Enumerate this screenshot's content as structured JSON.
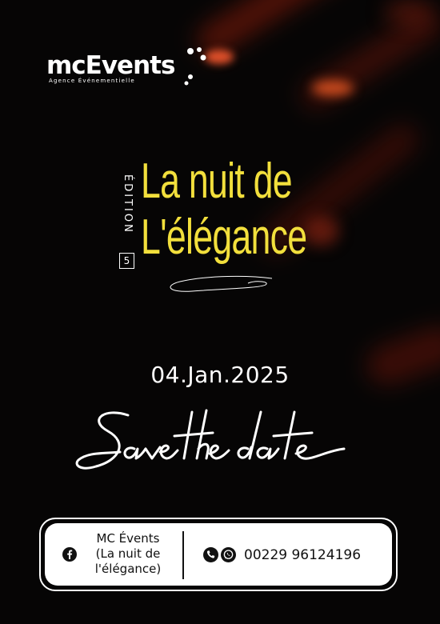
{
  "logo": {
    "name": "mcEvents",
    "tagline": "Agence Événementielle"
  },
  "title": {
    "edition_label": "ÉDITION",
    "edition_number": "5",
    "line1": "La nuit de",
    "line2": "L'élégance"
  },
  "event": {
    "date": "04.Jan.2025",
    "save_the_date": "Save the date"
  },
  "contact": {
    "name_lines": [
      "MC Évents",
      "(La nuit de",
      "l'élégance)"
    ],
    "phone": "00229 96124196",
    "icons": [
      "facebook-icon",
      "phone-icon",
      "whatsapp-icon"
    ]
  },
  "colors": {
    "background": "#050404",
    "title_yellow": "#f2df3c",
    "accent_orange": "#d9521a"
  }
}
